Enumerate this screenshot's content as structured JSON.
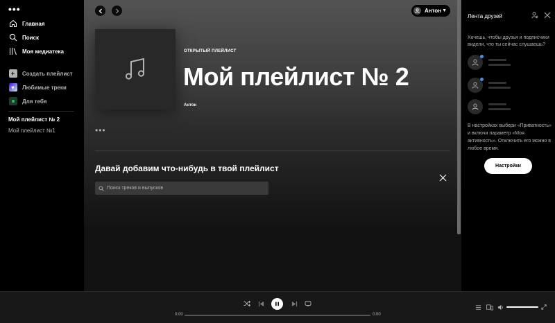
{
  "app": {
    "menu_glyph": "•••"
  },
  "sidebar": {
    "nav": [
      {
        "label": "Главная",
        "icon": "home-icon"
      },
      {
        "label": "Поиск",
        "icon": "search-icon"
      },
      {
        "label": "Моя медиатека",
        "icon": "library-icon"
      }
    ],
    "actions": [
      {
        "label": "Создать плейлист",
        "icon": "plus-icon"
      },
      {
        "label": "Любимые треки",
        "icon": "heart-icon"
      },
      {
        "label": "Для тебя",
        "icon": "podcast-icon"
      }
    ],
    "playlists": [
      "Мой плейлист № 2",
      "Мой плейлист №1"
    ]
  },
  "header": {
    "user_name": "Антон"
  },
  "playlist": {
    "type": "ОТКРЫТЫЙ ПЛЕЙЛИСТ",
    "title": "Мой плейлист № 2",
    "owner": "Антон",
    "more_glyph": "•••"
  },
  "add_section": {
    "heading": "Давай добавим что-нибудь в твой плейлист",
    "search_placeholder": "Поиск треков и выпусков"
  },
  "friends_panel": {
    "title": "Лента друзей",
    "prompt": "Хочешь, чтобы друзья и подписчики видели, что ты сейчас слушаешь?",
    "note": "В настройках выбери «Приватность» и включи параметр «Моя активность». Отключить его можно в любое время.",
    "settings_label": "Настройки"
  },
  "player": {
    "time_elapsed": "0:00",
    "time_total": "0:00",
    "volume_level": 1.0
  },
  "colors": {
    "accent_friend_dot": "#4a90d9",
    "background": "#121212"
  }
}
